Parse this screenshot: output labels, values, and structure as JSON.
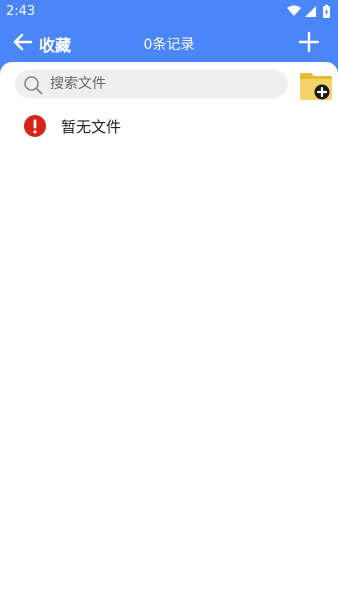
{
  "status_bar": {
    "time": "2:43",
    "icons": [
      "wifi-icon",
      "signal-icon",
      "battery-icon"
    ]
  },
  "app_bar": {
    "title": "收藏",
    "record_count": "0条记录",
    "back_icon": "arrow-left-icon",
    "add_icon": "plus-icon"
  },
  "search": {
    "placeholder": "搜索文件",
    "value": ""
  },
  "folder_action_icon": "folder-add-icon",
  "empty_state": {
    "icon": "warning-icon",
    "text": "暂无文件"
  },
  "colors": {
    "primary": "#4a86f7",
    "background": "#ffffff",
    "search_bg": "#efefef",
    "warning_red": "#d9231a",
    "folder_yellow": "#f6d36a"
  }
}
